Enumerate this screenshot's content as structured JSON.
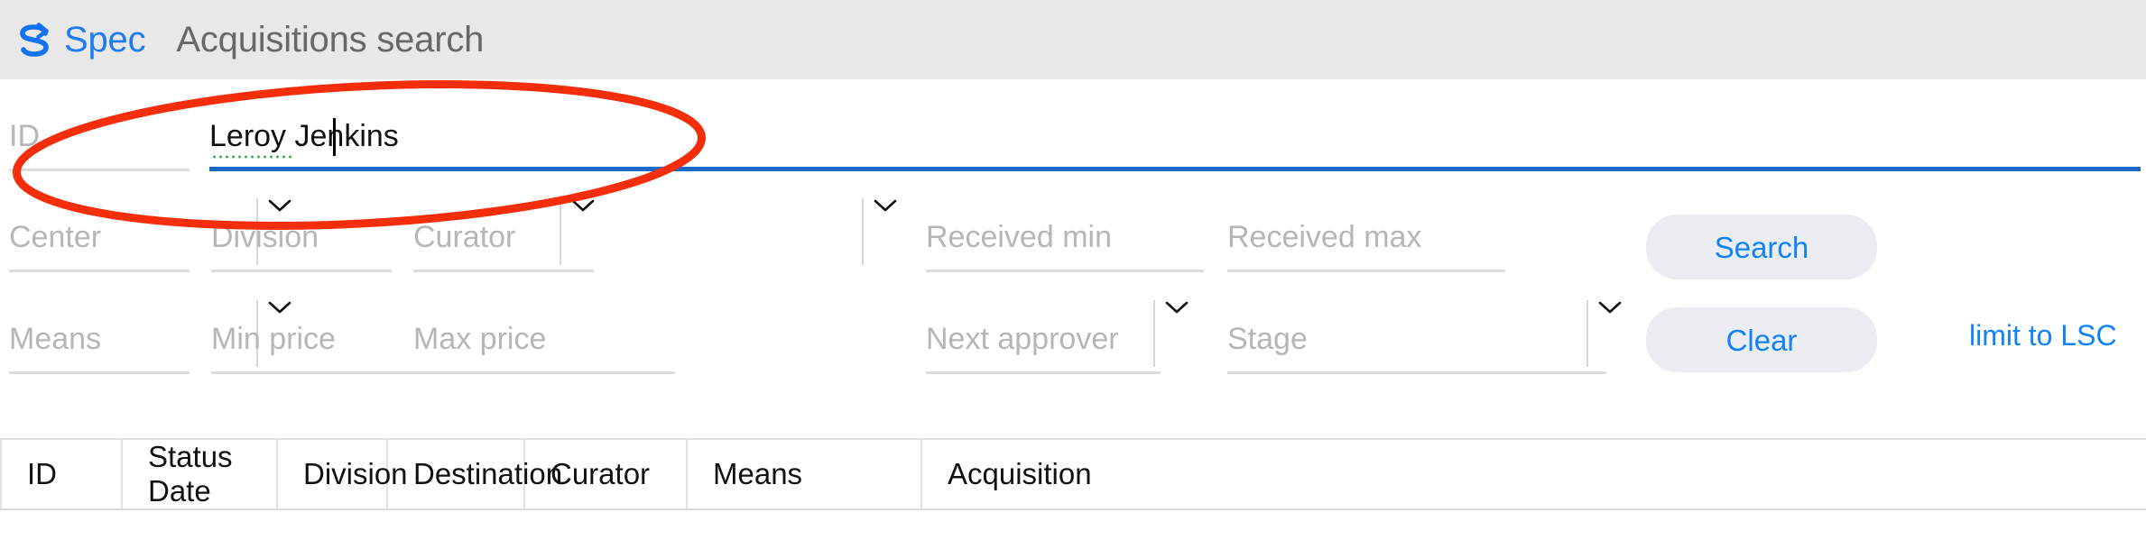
{
  "header": {
    "logo_icon": "spec-s-arrow-logo",
    "brand": "Spec",
    "title": "Acquisitions search",
    "brand_color": "#1f7bf0",
    "background_color": "#e8e8e8"
  },
  "search_form": {
    "row1": {
      "id_field": {
        "placeholder": "ID",
        "value": ""
      },
      "query_field": {
        "placeholder": "",
        "value": "Leroy Jenkins",
        "focused": true,
        "spellcheck_word": "Leroy",
        "caret_visible": true,
        "focus_color": "#1769c4"
      }
    },
    "row2": {
      "center": {
        "placeholder": "Center",
        "value": "",
        "type": "select",
        "icon": "chevron-down-icon"
      },
      "division": {
        "placeholder": "Division",
        "value": "",
        "type": "select",
        "icon": "chevron-down-icon"
      },
      "curator": {
        "placeholder": "Curator",
        "value": "",
        "type": "select",
        "icon": "chevron-down-icon"
      },
      "received_min": {
        "placeholder": "Received min",
        "value": "",
        "type": "text"
      },
      "received_max": {
        "placeholder": "Received max",
        "value": "",
        "type": "text"
      },
      "search_button": {
        "label": "Search"
      }
    },
    "row3": {
      "means": {
        "placeholder": "Means",
        "value": "",
        "type": "select",
        "icon": "chevron-down-icon"
      },
      "min_price": {
        "placeholder": "Min price",
        "value": "",
        "type": "text"
      },
      "max_price": {
        "placeholder": "Max price",
        "value": "",
        "type": "text"
      },
      "next_approver": {
        "placeholder": "Next approver",
        "value": "",
        "type": "select",
        "icon": "chevron-down-icon"
      },
      "stage": {
        "placeholder": "Stage",
        "value": "",
        "type": "select",
        "icon": "chevron-down-icon"
      },
      "clear_button": {
        "label": "Clear"
      },
      "limit_link": {
        "label": "limit to LSC"
      }
    }
  },
  "results": {
    "columns": [
      {
        "label": "ID"
      },
      {
        "label": "Status Date"
      },
      {
        "label": "Division"
      },
      {
        "label": "Destination"
      },
      {
        "label": "Curator"
      },
      {
        "label": "Means"
      },
      {
        "label": "Acquisition"
      }
    ],
    "rows": []
  },
  "annotation": {
    "type": "ellipse",
    "color": "#f42d0a",
    "target": "id-field-row"
  }
}
